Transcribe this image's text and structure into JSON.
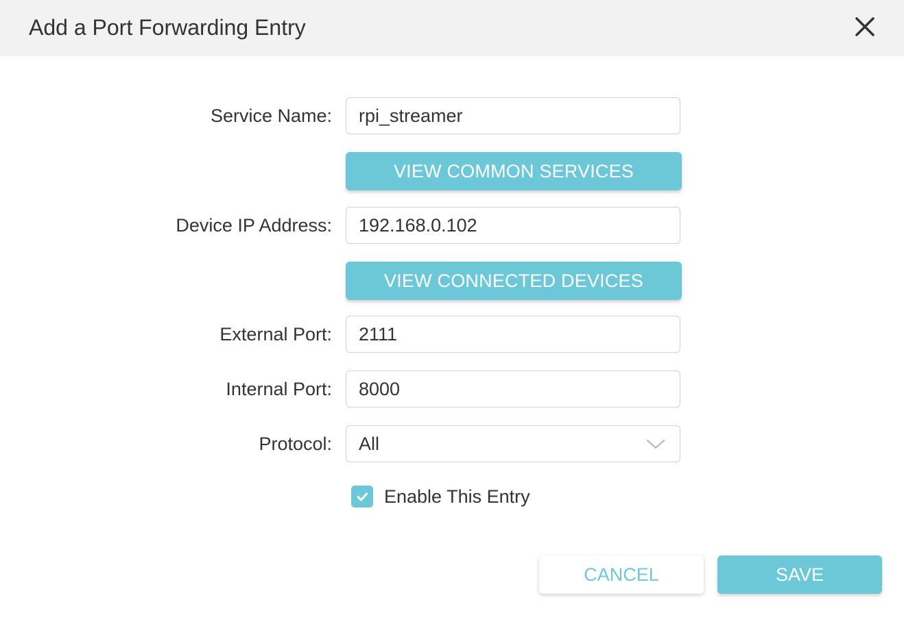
{
  "dialog": {
    "title": "Add a Port Forwarding Entry",
    "close_icon": "close-icon"
  },
  "form": {
    "service_name": {
      "label": "Service Name:",
      "value": "rpi_streamer"
    },
    "view_common_services_label": "VIEW COMMON SERVICES",
    "device_ip": {
      "label": "Device IP Address:",
      "value": "192.168.0.102"
    },
    "view_connected_devices_label": "VIEW CONNECTED DEVICES",
    "external_port": {
      "label": "External Port:",
      "value": "2111"
    },
    "internal_port": {
      "label": "Internal Port:",
      "value": "8000"
    },
    "protocol": {
      "label": "Protocol:",
      "value": "All",
      "icon": "chevron-down-icon"
    },
    "enable_entry": {
      "label": "Enable This Entry",
      "checked": true,
      "icon": "checkmark-icon"
    }
  },
  "footer": {
    "cancel_label": "CANCEL",
    "save_label": "SAVE"
  },
  "colors": {
    "accent": "#6cc8d8",
    "header_bg": "#f2f2f2",
    "text": "#333333",
    "border": "#cfcfcf"
  }
}
